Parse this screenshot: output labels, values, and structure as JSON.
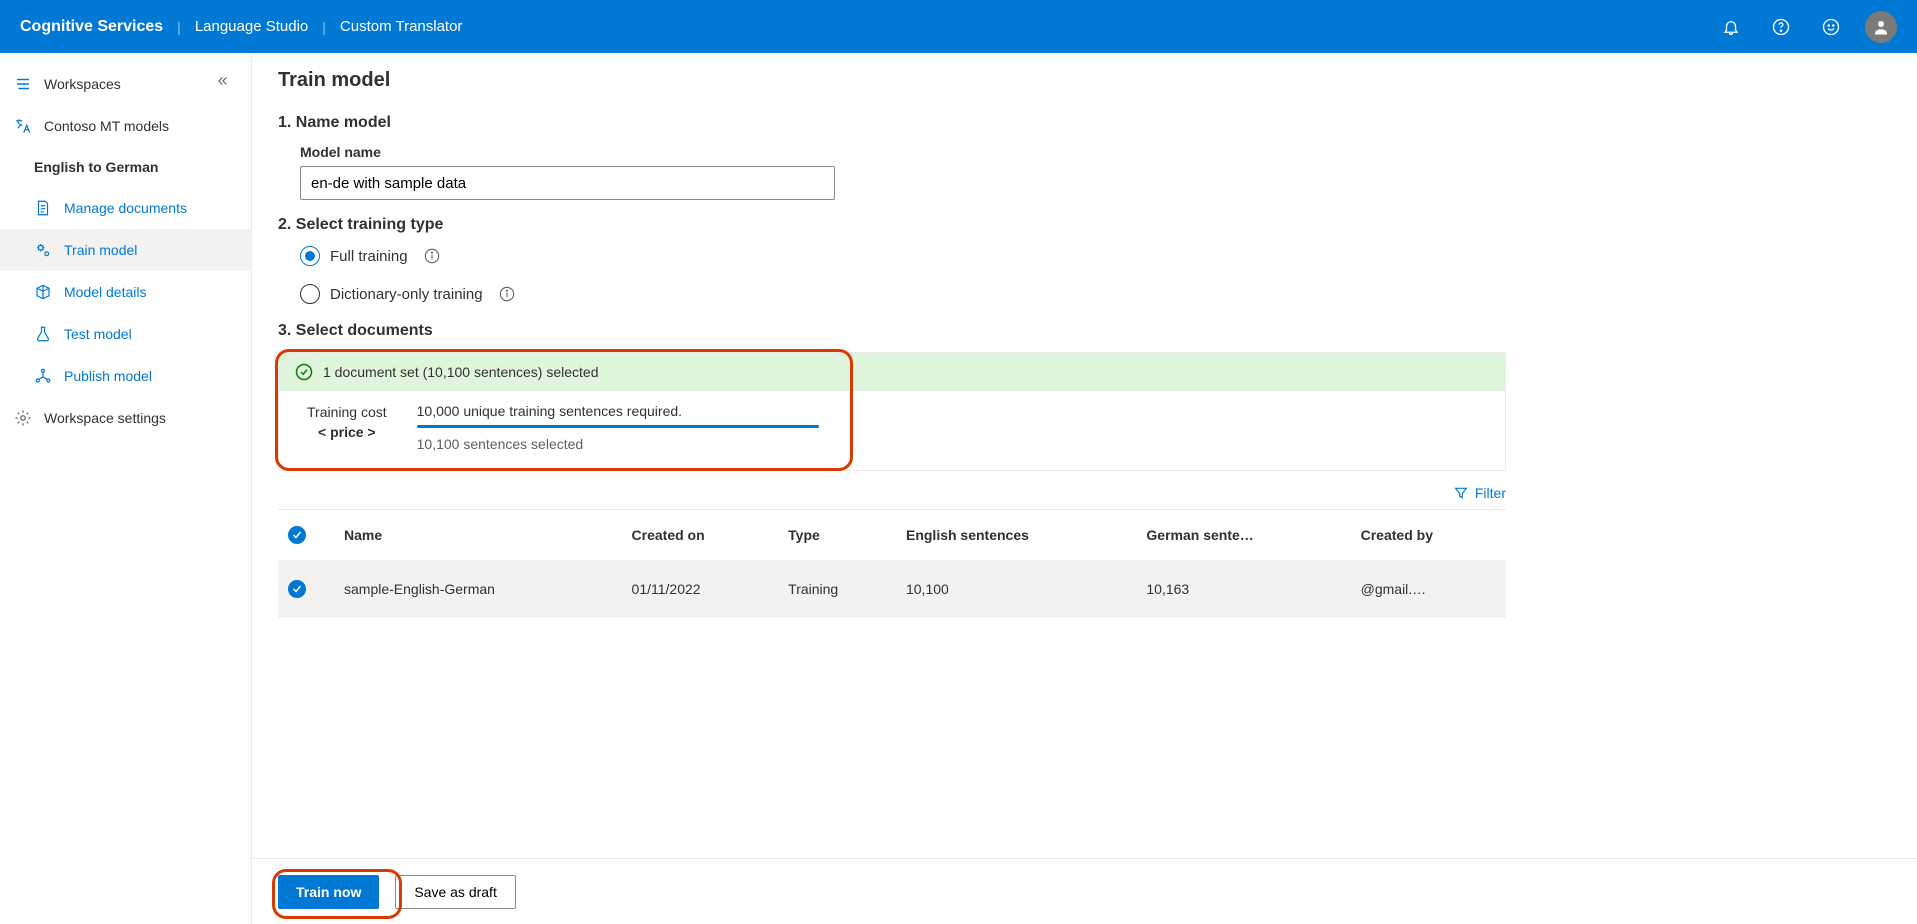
{
  "header": {
    "crumb1": "Cognitive Services",
    "crumb2": "Language Studio",
    "crumb3": "Custom Translator"
  },
  "sidebar": {
    "workspaces_label": "Workspaces",
    "workspace_name": "Contoso MT models",
    "project_name": "English to German",
    "items": [
      {
        "label": "Manage documents"
      },
      {
        "label": "Train model"
      },
      {
        "label": "Model details"
      },
      {
        "label": "Test model"
      },
      {
        "label": "Publish model"
      }
    ],
    "settings_label": "Workspace settings"
  },
  "page": {
    "title": "Train model",
    "sec1": "1. Name model",
    "model_name_label": "Model name",
    "model_name_value": "en-de with sample data",
    "sec2": "2. Select training type",
    "radio_full": "Full training",
    "radio_dict": "Dictionary-only training",
    "sec3": "3. Select documents",
    "selection_summary": "1 document set (10,100 sentences) selected",
    "training_cost_l1": "Training cost",
    "training_cost_l2": "< price >",
    "progress_required": "10,000 unique training sentences required.",
    "progress_selected": "10,100 sentences selected",
    "filter_label": "Filter"
  },
  "table": {
    "cols": [
      "Name",
      "Created on",
      "Type",
      "English sentences",
      "German sente…",
      "Created by"
    ],
    "row": {
      "name": "sample-English-German",
      "created_on": "01/11/2022",
      "type": "Training",
      "eng": "10,100",
      "ger": "10,163",
      "created_by": "@gmail.…"
    }
  },
  "footer": {
    "train_now": "Train now",
    "save_draft": "Save as draft"
  }
}
